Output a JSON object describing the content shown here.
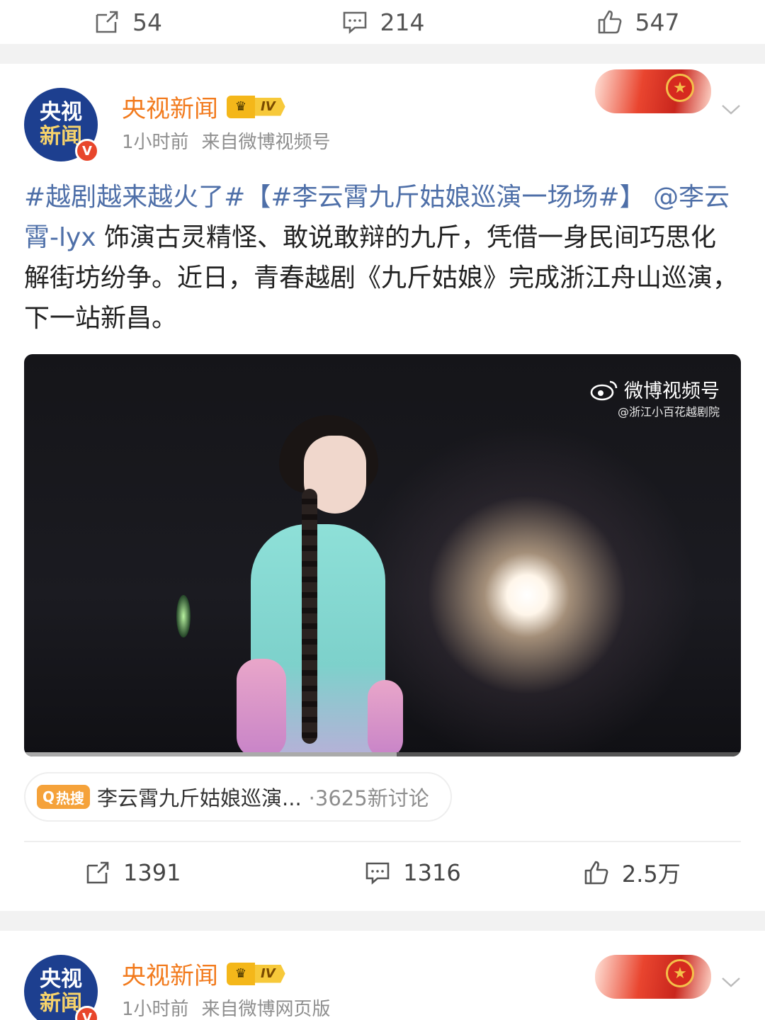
{
  "top_actions": {
    "repost_count": "54",
    "comment_count": "214",
    "like_count": "547"
  },
  "post": {
    "account": {
      "avatar_line1": "央视",
      "avatar_line2": "新闻",
      "verify_mark": "V",
      "name": "央视新闻",
      "level": "IV"
    },
    "time": "1小时前",
    "source": "来自微博视频号",
    "text": {
      "tag1": "#越剧越来越火了#",
      "tag2": "【#李云霄九斤姑娘巡演一场场#】",
      "mention": "@李云霄-lyx",
      "body": " 饰演古灵精怪、敢说敢辩的九斤，凭借一身民间巧思化解街坊纷争。近日，青春越剧《九斤姑娘》完成浙江舟山巡演，下一站新昌。"
    },
    "video": {
      "watermark": "微博视频号",
      "watermark_handle": "@浙江小百花越剧院",
      "progress": 0.52
    },
    "hot_search": {
      "tag_label": "热搜",
      "title": "李云霄九斤姑娘巡演...",
      "count": "·3625新讨论"
    },
    "actions": {
      "repost_count": "1391",
      "comment_count": "1316",
      "like_count": "2.5万"
    }
  },
  "next_post": {
    "account": {
      "avatar_line1": "央视",
      "avatar_line2": "新闻",
      "verify_mark": "V",
      "name": "央视新闻",
      "level": "IV"
    },
    "time": "1小时前",
    "source": "来自微博网页版"
  },
  "colors": {
    "accent_name": "#f27b1e",
    "link": "#4e6fa8",
    "hot_tag": "#f5a23a"
  }
}
